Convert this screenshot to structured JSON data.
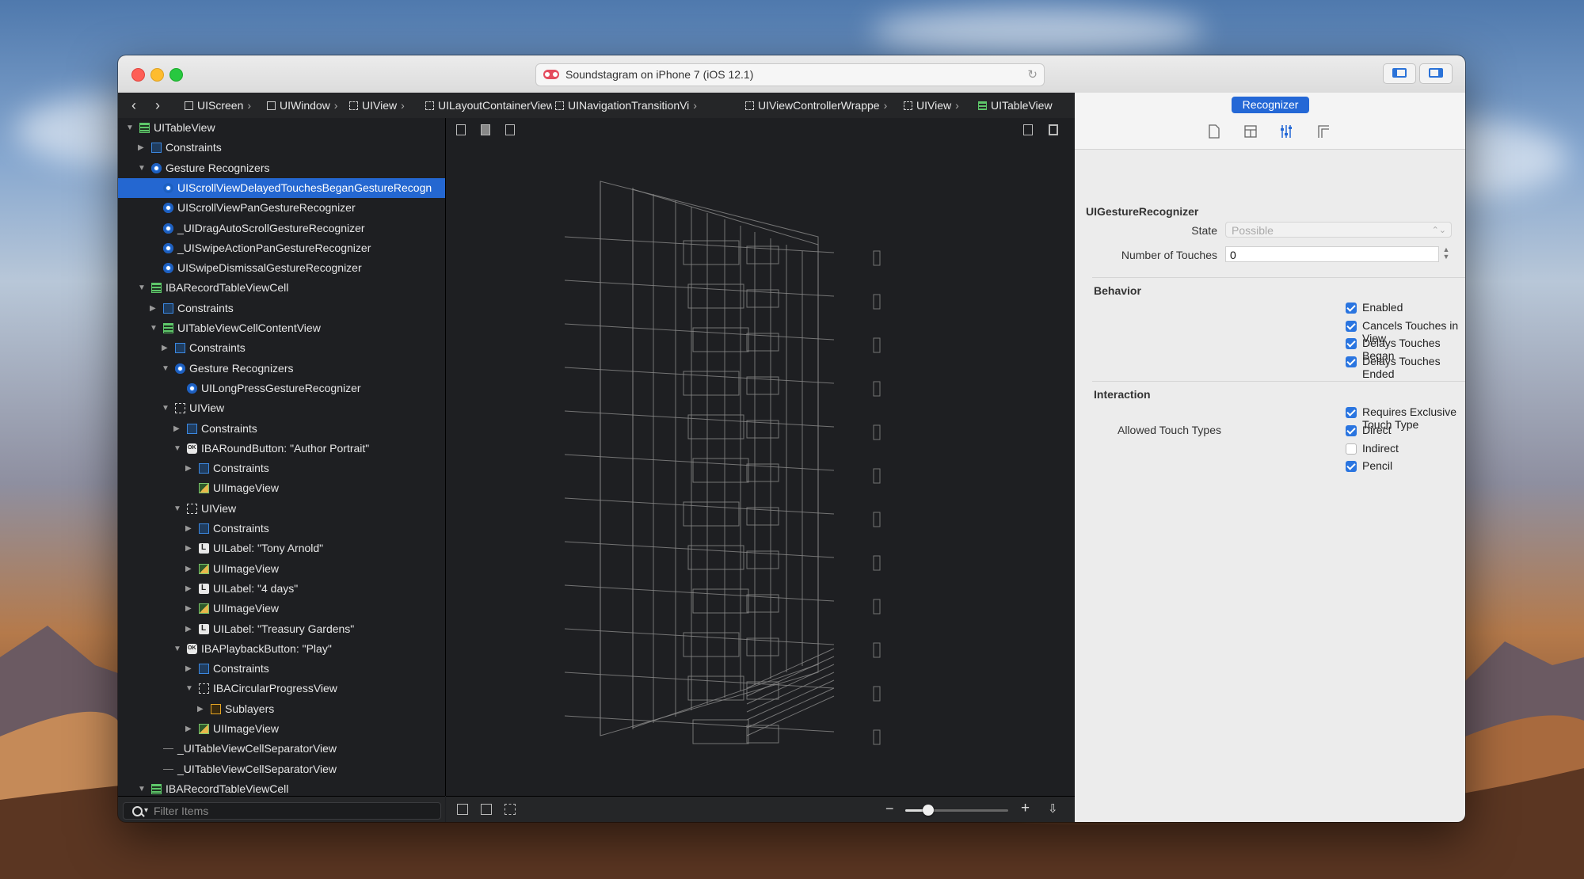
{
  "window": {
    "title": "Soundstagram on iPhone 7 (iOS 12.1)"
  },
  "jumpbar": {
    "crumbs": [
      {
        "label": "UIScreen",
        "icon": "screen-icon"
      },
      {
        "label": "UIWindow",
        "icon": "window-icon"
      },
      {
        "label": "UIView",
        "icon": "view-icon"
      },
      {
        "label": "UILayoutContainerView",
        "icon": "view-icon"
      },
      {
        "label": "UINavigationTransitionVi",
        "icon": "view-icon"
      },
      {
        "label": "UIViewControllerWrappe",
        "icon": "view-icon"
      },
      {
        "label": "UIView",
        "icon": "view-icon"
      },
      {
        "label": "UITableView",
        "icon": "tableview-icon"
      }
    ]
  },
  "outline": {
    "rows": [
      {
        "label": "UITableView",
        "depth": 0,
        "tri": "open",
        "icon": "tableview-icon"
      },
      {
        "label": "Constraints",
        "depth": 1,
        "tri": "closed",
        "icon": "constraints-icon"
      },
      {
        "label": "Gesture Recognizers",
        "depth": 1,
        "tri": "open",
        "icon": "gesture-recognizer-icon"
      },
      {
        "label": "UIScrollViewDelayedTouchesBeganGestureRecogn",
        "depth": 2,
        "tri": "none",
        "icon": "gesture-recognizer-icon",
        "selected": true
      },
      {
        "label": "UIScrollViewPanGestureRecognizer",
        "depth": 2,
        "tri": "none",
        "icon": "gesture-recognizer-icon"
      },
      {
        "label": "_UIDragAutoScrollGestureRecognizer",
        "depth": 2,
        "tri": "none",
        "icon": "gesture-recognizer-icon"
      },
      {
        "label": "_UISwipeActionPanGestureRecognizer",
        "depth": 2,
        "tri": "none",
        "icon": "gesture-recognizer-icon"
      },
      {
        "label": "UISwipeDismissalGestureRecognizer",
        "depth": 2,
        "tri": "none",
        "icon": "gesture-recognizer-icon"
      },
      {
        "label": "IBARecordTableViewCell",
        "depth": 1,
        "tri": "open",
        "icon": "tableview-icon"
      },
      {
        "label": "Constraints",
        "depth": 2,
        "tri": "closed",
        "icon": "constraints-icon"
      },
      {
        "label": "UITableViewCellContentView",
        "depth": 2,
        "tri": "open",
        "icon": "tableview-icon"
      },
      {
        "label": "Constraints",
        "depth": 3,
        "tri": "closed",
        "icon": "constraints-icon"
      },
      {
        "label": "Gesture Recognizers",
        "depth": 3,
        "tri": "open",
        "icon": "gesture-recognizer-icon"
      },
      {
        "label": "UILongPressGestureRecognizer",
        "depth": 4,
        "tri": "none",
        "icon": "gesture-recognizer-icon"
      },
      {
        "label": "UIView",
        "depth": 3,
        "tri": "open",
        "icon": "view-icon"
      },
      {
        "label": "Constraints",
        "depth": 4,
        "tri": "closed",
        "icon": "constraints-icon"
      },
      {
        "label": "IBARoundButton: \"Author Portrait\"",
        "depth": 4,
        "tri": "open",
        "icon": "button-icon"
      },
      {
        "label": "Constraints",
        "depth": 5,
        "tri": "closed",
        "icon": "constraints-icon"
      },
      {
        "label": "UIImageView",
        "depth": 5,
        "tri": "none",
        "icon": "imageview-icon"
      },
      {
        "label": "UIView",
        "depth": 4,
        "tri": "open",
        "icon": "view-icon"
      },
      {
        "label": "Constraints",
        "depth": 5,
        "tri": "closed",
        "icon": "constraints-icon"
      },
      {
        "label": "UILabel: \"Tony Arnold\"",
        "depth": 5,
        "tri": "closed",
        "icon": "label-icon"
      },
      {
        "label": "UIImageView",
        "depth": 5,
        "tri": "closed",
        "icon": "imageview-icon"
      },
      {
        "label": "UILabel: \"4 days\"",
        "depth": 5,
        "tri": "closed",
        "icon": "label-icon"
      },
      {
        "label": "UIImageView",
        "depth": 5,
        "tri": "closed",
        "icon": "imageview-icon"
      },
      {
        "label": "UILabel: \"Treasury Gardens\"",
        "depth": 5,
        "tri": "closed",
        "icon": "label-icon"
      },
      {
        "label": "IBAPlaybackButton: \"Play\"",
        "depth": 4,
        "tri": "open",
        "icon": "button-icon"
      },
      {
        "label": "Constraints",
        "depth": 5,
        "tri": "closed",
        "icon": "constraints-icon"
      },
      {
        "label": "IBACircularProgressView",
        "depth": 5,
        "tri": "open",
        "icon": "view-icon"
      },
      {
        "label": "Sublayers",
        "depth": 6,
        "tri": "closed",
        "icon": "layer-icon"
      },
      {
        "label": "UIImageView",
        "depth": 5,
        "tri": "closed",
        "icon": "imageview-icon"
      },
      {
        "label": "_UITableViewCellSeparatorView",
        "depth": 2,
        "tri": "none",
        "icon": "separator-icon"
      },
      {
        "label": "_UITableViewCellSeparatorView",
        "depth": 2,
        "tri": "none",
        "icon": "separator-icon"
      },
      {
        "label": "IBARecordTableViewCell",
        "depth": 1,
        "tri": "open",
        "icon": "tableview-icon"
      }
    ]
  },
  "filter": {
    "placeholder": "Filter Items"
  },
  "canvas": {
    "zoom_fraction": 0.22
  },
  "inspector": {
    "tab_label": "Recognizer",
    "class_title": "UIGestureRecognizer",
    "state_label": "State",
    "state_value": "Possible",
    "touches_label": "Number of Touches",
    "touches_value": "0",
    "behavior_title": "Behavior",
    "behavior": [
      {
        "label": "Enabled",
        "checked": true
      },
      {
        "label": "Cancels Touches in View",
        "checked": true
      },
      {
        "label": "Delays Touches Began",
        "checked": true
      },
      {
        "label": "Delays Touches Ended",
        "checked": true
      }
    ],
    "interaction_title": "Interaction",
    "exclusive": {
      "label": "Requires Exclusive Touch Type",
      "checked": true
    },
    "touch_types_label": "Allowed Touch Types",
    "touch_types": [
      {
        "label": "Direct",
        "checked": true
      },
      {
        "label": "Indirect",
        "checked": false
      },
      {
        "label": "Pencil",
        "checked": true
      }
    ]
  },
  "colors": {
    "accent": "#2468d6",
    "selection": "#2467d1"
  }
}
